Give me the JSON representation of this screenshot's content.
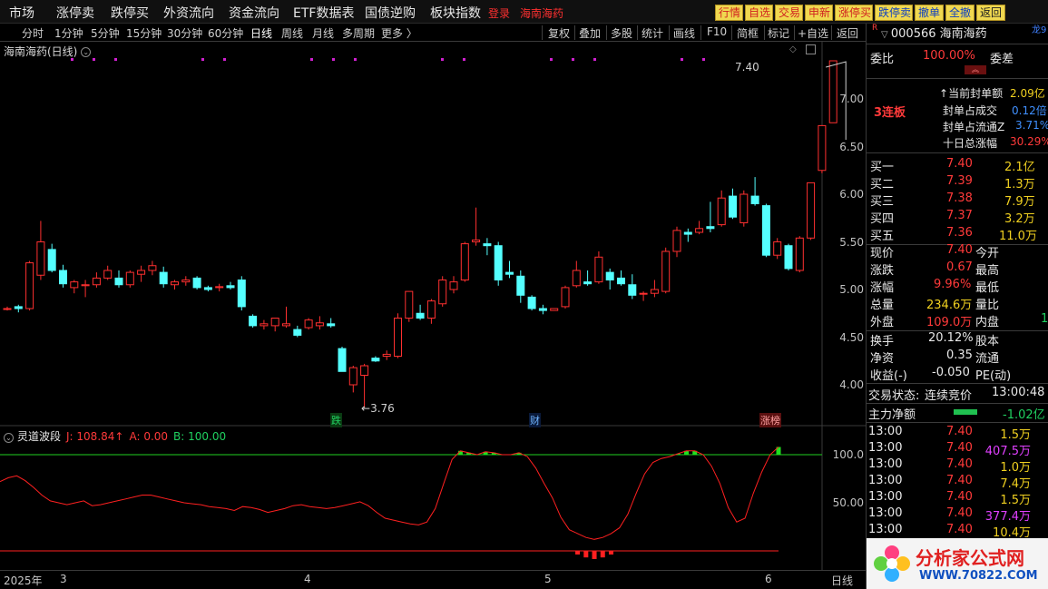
{
  "topbar": {
    "menus": [
      "市场",
      "涨停卖",
      "跌停买",
      "外资流向",
      "资金流向",
      "ETF数据表",
      "国债逆购",
      "板块指数"
    ],
    "login": "登录",
    "stock_name": "海南海药",
    "buttons": [
      "行情",
      "自选",
      "交易",
      "申新",
      "涨停买",
      "跌停卖",
      "撤单",
      "全撤",
      "返回"
    ]
  },
  "periods": [
    "分时",
    "1分钟",
    "5分钟",
    "15分钟",
    "30分钟",
    "60分钟",
    "日线",
    "周线",
    "月线",
    "多周期",
    "更多 〉"
  ],
  "tools": [
    "复权",
    "叠加",
    "多股",
    "统计",
    "画线",
    "F10",
    "简框",
    "标记",
    "+自选",
    "返回"
  ],
  "chart": {
    "title": "海南海药(日线)",
    "y_ticks": [
      "7.00",
      "6.50",
      "6.00",
      "5.50",
      "5.00",
      "4.50",
      "4.00"
    ],
    "high_label": "7.40",
    "low_label": "3.76",
    "markers": [
      "跌",
      "财",
      "涨榜"
    ]
  },
  "indicator": {
    "name": "灵道波段",
    "j_label": "J: 108.84↑",
    "a_label": "A: 0.00",
    "b_label": "B: 100.00",
    "y_ticks": [
      "100.0",
      "50.00"
    ]
  },
  "datebar": {
    "labels": [
      "2025年",
      "3",
      "4",
      "5",
      "6"
    ],
    "period": "日线"
  },
  "quote": {
    "code_line": "000566 海南海药",
    "r_badge": "R",
    "dragon": "龙9",
    "weibi_label": "委比",
    "weibi_value": "100.00%",
    "weicha_label": "委差",
    "limit_tag": "3连板",
    "seal_amount_label": "当前封单额",
    "seal_amount_value": "2.09亿",
    "seal_turnover_label": "封单占成交",
    "seal_turnover_value": "0.12倍",
    "seal_float_label": "封单占流通Z",
    "seal_float_value": "3.71%",
    "ten_day_label": "十日总涨幅",
    "ten_day_value": "30.29%",
    "bids": [
      {
        "label": "买一",
        "price": "7.40",
        "vol": "2.1亿"
      },
      {
        "label": "买二",
        "price": "7.39",
        "vol": "1.3万"
      },
      {
        "label": "买三",
        "price": "7.38",
        "vol": "7.9万"
      },
      {
        "label": "买四",
        "price": "7.37",
        "vol": "3.2万"
      },
      {
        "label": "买五",
        "price": "7.36",
        "vol": "11.0万"
      }
    ],
    "stats": [
      {
        "l1": "现价",
        "v1": "7.40",
        "l2": "今开",
        "v2": ""
      },
      {
        "l1": "涨跌",
        "v1": "0.67",
        "l2": "最高",
        "v2": ""
      },
      {
        "l1": "涨幅",
        "v1": "9.96%",
        "l2": "最低",
        "v2": ""
      },
      {
        "l1": "总量",
        "v1": "234.6万",
        "l2": "量比",
        "v2": ""
      },
      {
        "l1": "外盘",
        "v1": "109.0万",
        "l2": "内盘",
        "v2": "1."
      }
    ],
    "stats2": [
      {
        "l1": "换手",
        "v1": "20.12%",
        "l2": "股本"
      },
      {
        "l1": "净资",
        "v1": "0.35",
        "l2": "流通"
      },
      {
        "l1": "收益(-)",
        "v1": "-0.050",
        "l2": "PE(动)"
      }
    ],
    "trade_status_label": "交易状态:",
    "trade_status_value": "连续竞价",
    "trade_time": "13:00:48",
    "main_flow_label": "主力净额",
    "main_flow_value": "-1.02亿",
    "ticks": [
      {
        "time": "13:00",
        "price": "7.40",
        "vol": "1.5万",
        "big": false
      },
      {
        "time": "13:00",
        "price": "7.40",
        "vol": "407.5万",
        "big": true
      },
      {
        "time": "13:00",
        "price": "7.40",
        "vol": "1.0万",
        "big": false
      },
      {
        "time": "13:00",
        "price": "7.40",
        "vol": "7.4万",
        "big": false
      },
      {
        "time": "13:00",
        "price": "7.40",
        "vol": "1.5万",
        "big": false
      },
      {
        "time": "13:00",
        "price": "7.40",
        "vol": "377.4万",
        "big": true
      },
      {
        "time": "13:00",
        "price": "7.40",
        "vol": "10.4万",
        "big": false
      }
    ]
  },
  "logo": {
    "text": "分析家公式网",
    "url": "WWW.70822.COM"
  },
  "candles": [
    [
      4.8,
      4.82,
      4.78,
      4.8
    ],
    [
      4.82,
      4.84,
      4.76,
      4.8
    ],
    [
      4.8,
      5.3,
      4.78,
      5.28
    ],
    [
      5.15,
      5.72,
      5.1,
      5.5
    ],
    [
      5.42,
      5.48,
      5.18,
      5.2
    ],
    [
      5.2,
      5.26,
      5.02,
      5.06
    ],
    [
      5.02,
      5.1,
      4.96,
      5.08
    ],
    [
      5.04,
      5.1,
      4.92,
      5.05
    ],
    [
      5.05,
      5.18,
      5.02,
      5.12
    ],
    [
      5.12,
      5.25,
      5.1,
      5.2
    ],
    [
      5.12,
      5.2,
      5.02,
      5.05
    ],
    [
      5.05,
      5.2,
      5.02,
      5.18
    ],
    [
      5.16,
      5.25,
      5.08,
      5.2
    ],
    [
      5.2,
      5.3,
      5.15,
      5.25
    ],
    [
      5.18,
      5.24,
      5.02,
      5.06
    ],
    [
      5.05,
      5.1,
      5.0,
      5.08
    ],
    [
      5.08,
      5.14,
      5.04,
      5.1
    ],
    [
      5.12,
      5.14,
      5.0,
      5.02
    ],
    [
      5.02,
      5.04,
      4.98,
      5.0
    ],
    [
      5.02,
      5.06,
      4.98,
      5.03
    ],
    [
      5.04,
      5.08,
      5.0,
      5.02
    ],
    [
      5.1,
      5.14,
      4.78,
      4.82
    ],
    [
      4.72,
      4.74,
      4.6,
      4.62
    ],
    [
      4.62,
      4.68,
      4.58,
      4.64
    ],
    [
      4.62,
      4.7,
      4.56,
      4.7
    ],
    [
      4.62,
      4.82,
      4.6,
      4.64
    ],
    [
      4.58,
      4.62,
      4.5,
      4.52
    ],
    [
      4.6,
      4.7,
      4.58,
      4.68
    ],
    [
      4.62,
      4.72,
      4.58,
      4.65
    ],
    [
      4.64,
      4.7,
      4.6,
      4.62
    ],
    [
      4.38,
      4.4,
      4.14,
      4.14
    ],
    [
      4.0,
      4.2,
      3.92,
      4.18
    ],
    [
      4.1,
      4.22,
      3.76,
      4.2
    ],
    [
      4.28,
      4.3,
      4.24,
      4.25
    ],
    [
      4.3,
      4.36,
      4.26,
      4.32
    ],
    [
      4.3,
      4.75,
      4.28,
      4.7
    ],
    [
      4.7,
      4.98,
      4.66,
      4.98
    ],
    [
      4.75,
      4.84,
      4.68,
      4.7
    ],
    [
      4.7,
      4.9,
      4.64,
      4.88
    ],
    [
      4.85,
      5.14,
      4.82,
      5.1
    ],
    [
      5.0,
      5.14,
      4.96,
      5.08
    ],
    [
      5.1,
      5.5,
      5.08,
      5.48
    ],
    [
      5.5,
      5.86,
      5.46,
      5.52
    ],
    [
      5.48,
      5.54,
      5.36,
      5.46
    ],
    [
      5.46,
      5.5,
      5.04,
      5.1
    ],
    [
      5.18,
      5.3,
      5.12,
      5.16
    ],
    [
      5.14,
      5.2,
      4.86,
      4.94
    ],
    [
      4.92,
      4.94,
      4.78,
      4.8
    ],
    [
      4.8,
      4.84,
      4.74,
      4.78
    ],
    [
      4.78,
      4.8,
      4.78,
      4.8
    ],
    [
      4.82,
      5.04,
      4.8,
      5.02
    ],
    [
      5.04,
      5.3,
      5.02,
      5.2
    ],
    [
      5.08,
      5.2,
      5.04,
      5.06
    ],
    [
      5.08,
      5.4,
      5.06,
      5.34
    ],
    [
      5.18,
      5.22,
      5.0,
      5.1
    ],
    [
      5.12,
      5.2,
      5.04,
      5.06
    ],
    [
      5.05,
      5.16,
      4.9,
      4.94
    ],
    [
      4.96,
      4.98,
      4.88,
      4.96
    ],
    [
      4.96,
      5.1,
      4.92,
      5.0
    ],
    [
      4.98,
      5.44,
      4.96,
      5.4
    ],
    [
      5.4,
      5.66,
      5.34,
      5.62
    ],
    [
      5.6,
      5.64,
      5.5,
      5.58
    ],
    [
      5.6,
      5.72,
      5.58,
      5.64
    ],
    [
      5.66,
      5.92,
      5.6,
      5.64
    ],
    [
      5.68,
      6.04,
      5.66,
      5.96
    ],
    [
      5.98,
      6.06,
      5.74,
      5.76
    ],
    [
      5.7,
      6.04,
      5.66,
      6.0
    ],
    [
      5.98,
      6.18,
      5.88,
      5.9
    ],
    [
      5.88,
      5.9,
      5.34,
      5.36
    ],
    [
      5.36,
      5.54,
      5.32,
      5.5
    ],
    [
      5.46,
      5.48,
      5.2,
      5.22
    ],
    [
      5.2,
      5.56,
      5.18,
      5.54
    ],
    [
      5.54,
      6.12,
      5.52,
      6.12
    ],
    [
      6.25,
      6.72,
      6.22,
      6.72
    ],
    [
      6.75,
      7.4,
      6.8,
      7.4
    ]
  ],
  "osc": [
    72,
    76,
    78,
    73,
    66,
    58,
    52,
    50,
    48,
    50,
    52,
    47,
    48,
    50,
    52,
    54,
    56,
    58,
    58,
    56,
    54,
    52,
    50,
    49,
    48,
    46,
    45,
    44,
    42,
    46,
    45,
    43,
    40,
    42,
    44,
    47,
    48,
    46,
    45,
    44,
    45,
    47,
    49,
    51,
    47,
    40,
    34,
    32,
    30,
    28,
    27,
    30,
    44,
    70,
    95,
    104,
    102,
    100,
    103,
    102,
    100,
    100,
    102,
    98,
    86,
    70,
    55,
    35,
    22,
    18,
    14,
    12,
    14,
    18,
    24,
    38,
    60,
    80,
    92,
    96,
    98,
    101,
    104,
    104,
    100,
    88,
    70,
    45,
    30,
    34,
    60,
    82,
    100,
    108
  ]
}
